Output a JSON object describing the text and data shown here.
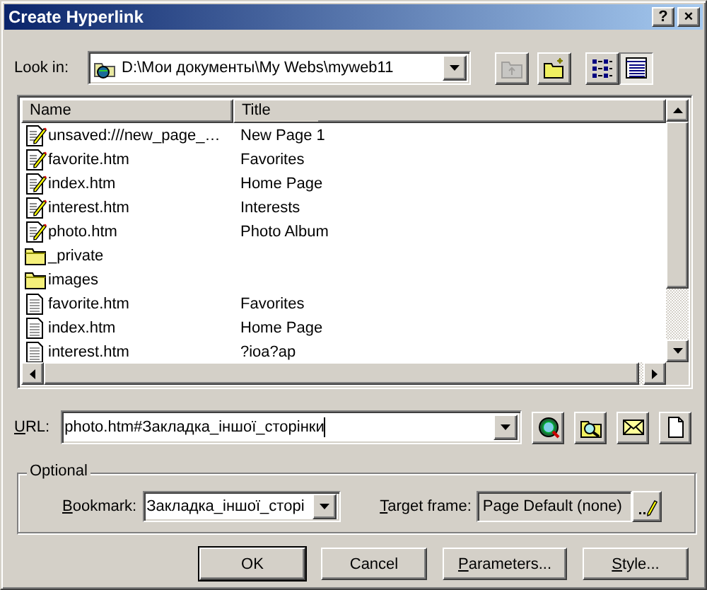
{
  "window": {
    "title": "Create Hyperlink",
    "buttons": [
      {
        "kind": "help",
        "label": "?"
      },
      {
        "kind": "close",
        "label": "×"
      }
    ]
  },
  "look_in": {
    "label": "Look in:",
    "value": "D:\\Мои документы\\My Webs\\myweb11"
  },
  "toolbar": [
    {
      "kind": "up_folder",
      "disabled": true,
      "pressed": false
    },
    {
      "kind": "new_folder",
      "disabled": false,
      "pressed": false
    },
    {
      "kind": "list_view",
      "disabled": false,
      "pressed": false
    },
    {
      "kind": "details_view",
      "disabled": false,
      "pressed": true
    }
  ],
  "file_list": {
    "columns": [
      "Name",
      "Title"
    ],
    "rows": [
      {
        "kind": "edited_page",
        "name": "unsaved:///new_page_…",
        "title": "New Page 1"
      },
      {
        "kind": "edited_page",
        "name": "favorite.htm",
        "title": "Favorites"
      },
      {
        "kind": "edited_page",
        "name": "index.htm",
        "title": "Home Page"
      },
      {
        "kind": "edited_page",
        "name": "interest.htm",
        "title": "Interests"
      },
      {
        "kind": "edited_page",
        "name": "photo.htm",
        "title": "Photo Album"
      },
      {
        "kind": "folder",
        "name": "_private"
      },
      {
        "kind": "folder",
        "name": "images"
      },
      {
        "kind": "page",
        "name": "favorite.htm",
        "title": "Favorites"
      },
      {
        "kind": "page",
        "name": "index.htm",
        "title": "Home Page"
      },
      {
        "kind": "page",
        "name": "interest.htm",
        "title": "?ioa?ap"
      }
    ]
  },
  "url": {
    "label": "URL:",
    "underline_first": true,
    "value": "photo.htm#Закладка_іншої_сторінки",
    "buttons": [
      {
        "kind": "web"
      },
      {
        "kind": "find_file"
      },
      {
        "kind": "email"
      },
      {
        "kind": "new_page"
      }
    ]
  },
  "optional": {
    "title": "Optional",
    "bookmark": {
      "label": "Bookmark:",
      "underline_first": true,
      "value": "Закладка_іншої_сторі"
    },
    "target_frame": {
      "label": "Target frame:",
      "underline_first": true,
      "value": "Page Default (none)"
    }
  },
  "buttons": [
    {
      "label": "OK",
      "default": true,
      "underline_first": false
    },
    {
      "label": "Cancel",
      "default": false,
      "underline_first": false
    },
    {
      "label": "Parameters...",
      "default": false,
      "underline_first": true
    },
    {
      "label": "Style...",
      "default": false,
      "underline_first": true
    }
  ]
}
